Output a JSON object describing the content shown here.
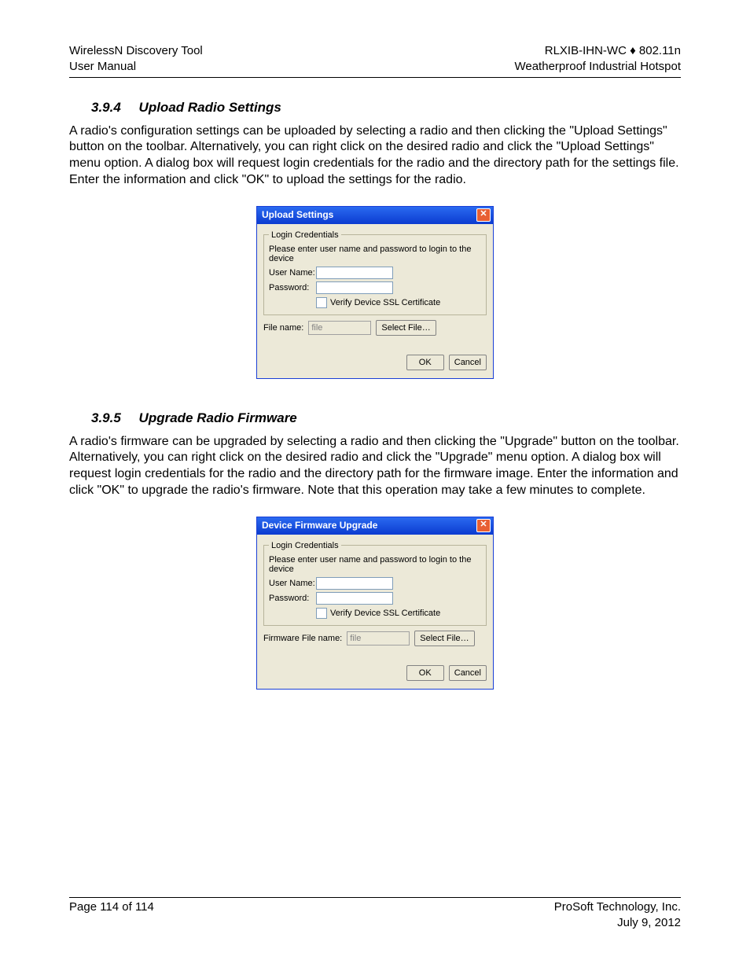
{
  "header": {
    "left1": "WirelessN Discovery Tool",
    "left2": "User Manual",
    "right1": "RLXIB-IHN-WC ♦ 802.11n",
    "right2": "Weatherproof Industrial Hotspot"
  },
  "sections": {
    "s1": {
      "num": "3.9.4",
      "title": "Upload Radio Settings",
      "body": "A radio's configuration settings can be uploaded by selecting a radio and then clicking the \"Upload Settings\" button on the toolbar. Alternatively, you can right click on the desired radio and click the \"Upload Settings\" menu option. A dialog box will request login credentials for the radio and the directory path for the settings file. Enter the information and click \"OK\" to upload the settings for the radio."
    },
    "s2": {
      "num": "3.9.5",
      "title": "Upgrade Radio Firmware",
      "body": "A radio's firmware can be upgraded by selecting a radio and then clicking the \"Upgrade\" button on the toolbar. Alternatively, you can right click on the desired radio and click the \"Upgrade\" menu option. A dialog box will request login credentials for the radio and the directory path for the firmware image. Enter the information and click \"OK\" to upgrade the radio's firmware. Note that this operation may take a few minutes to complete."
    }
  },
  "dlg": {
    "legend": "Login Credentials",
    "instruction": "Please enter user name and password to login to the device",
    "user_label": "User Name:",
    "pass_label": "Password:",
    "verify_label": "Verify Device SSL Certificate",
    "file_placeholder": "file",
    "select_file": "Select File…",
    "ok": "OK",
    "cancel": "Cancel",
    "titles": {
      "upload": "Upload Settings",
      "upgrade": "Device Firmware Upgrade"
    },
    "file_label": {
      "upload": "File name:",
      "upgrade": "Firmware File name:"
    }
  },
  "footer": {
    "page": "Page 114 of 114",
    "company": "ProSoft Technology, Inc.",
    "date": "July 9, 2012"
  }
}
